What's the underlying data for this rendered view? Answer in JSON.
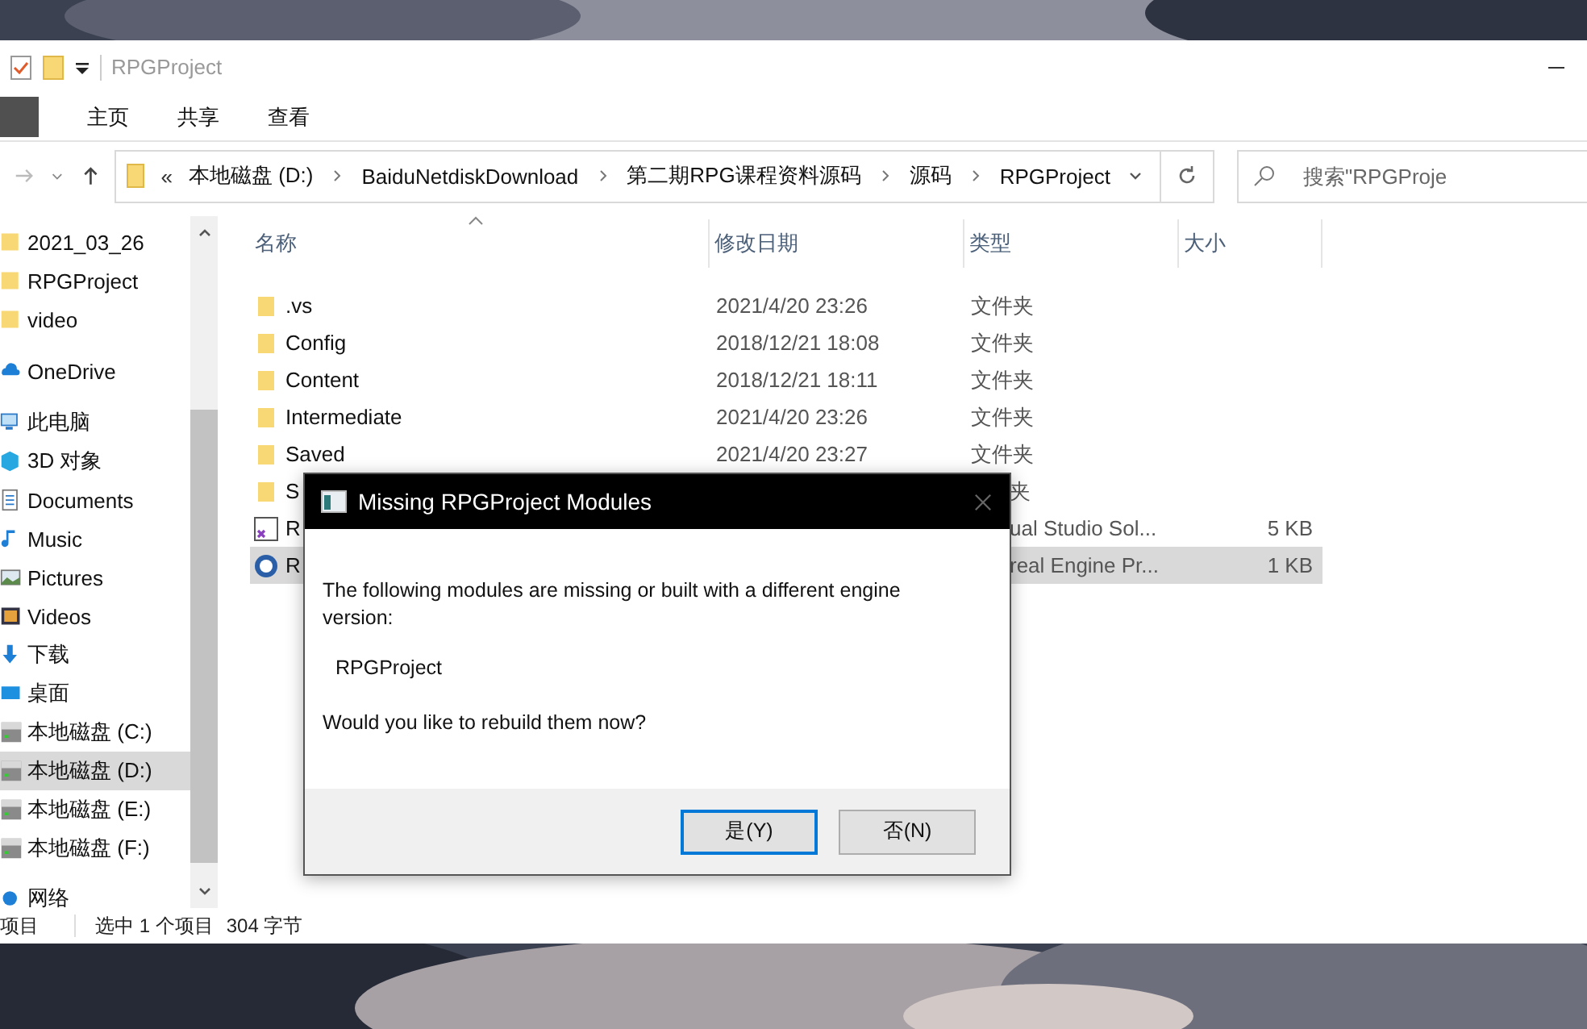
{
  "window": {
    "title": "RPGProject"
  },
  "ribbon_tabs": [
    {
      "label": "主页",
      "selected": false
    },
    {
      "label": "共享",
      "selected": false
    },
    {
      "label": "查看",
      "selected": false
    }
  ],
  "address_bar": {
    "overflow": "«",
    "crumbs": [
      "本地磁盘 (D:)",
      "BaiduNetdiskDownload",
      "第二期RPG课程资料源码",
      "源码",
      "RPGProject"
    ]
  },
  "search": {
    "placeholder": "搜索\"RPGProje"
  },
  "sidebar": {
    "items": [
      {
        "label": "2021_03_26",
        "kind": "folder",
        "selected": false
      },
      {
        "label": "RPGProject",
        "kind": "folder",
        "selected": false
      },
      {
        "label": "video",
        "kind": "folder",
        "selected": false
      },
      {
        "label": "OneDrive",
        "kind": "cloud",
        "selected": false
      },
      {
        "label": "此电脑",
        "kind": "pc",
        "selected": false
      },
      {
        "label": "3D 对象",
        "kind": "cube",
        "selected": false
      },
      {
        "label": "Documents",
        "kind": "doc",
        "selected": false
      },
      {
        "label": "Music",
        "kind": "music",
        "selected": false
      },
      {
        "label": "Pictures",
        "kind": "pictures",
        "selected": false
      },
      {
        "label": "Videos",
        "kind": "videos",
        "selected": false
      },
      {
        "label": "下载",
        "kind": "download",
        "selected": false
      },
      {
        "label": "桌面",
        "kind": "desktop",
        "selected": false
      },
      {
        "label": "本地磁盘 (C:)",
        "kind": "drive",
        "selected": false
      },
      {
        "label": "本地磁盘 (D:)",
        "kind": "drive",
        "selected": true
      },
      {
        "label": "本地磁盘 (E:)",
        "kind": "drive",
        "selected": false
      },
      {
        "label": "本地磁盘 (F:)",
        "kind": "drive",
        "selected": false
      },
      {
        "label": "网络",
        "kind": "network",
        "selected": false
      }
    ]
  },
  "table": {
    "columns": [
      "名称",
      "修改日期",
      "类型",
      "大小"
    ],
    "rows": [
      {
        "kind": "folder",
        "name": ".vs",
        "date": "2021/4/20 23:26",
        "type": "文件夹",
        "selected": false,
        "covered": false
      },
      {
        "kind": "folder",
        "name": "Config",
        "date": "2018/12/21 18:08",
        "type": "文件夹",
        "selected": false,
        "covered": false
      },
      {
        "kind": "folder",
        "name": "Content",
        "date": "2018/12/21 18:11",
        "type": "文件夹",
        "selected": false,
        "covered": false
      },
      {
        "kind": "folder",
        "name": "Intermediate",
        "date": "2021/4/20 23:26",
        "type": "文件夹",
        "selected": false,
        "covered": false
      },
      {
        "kind": "folder",
        "name": "Saved",
        "date": "2021/4/20 23:27",
        "type": "文件夹",
        "selected": false,
        "covered": false
      },
      {
        "kind": "folder",
        "name": "S",
        "type": "夹",
        "selected": false,
        "covered": true
      },
      {
        "kind": "solution",
        "name": "R",
        "type": "ual Studio Sol...",
        "size": "5 KB",
        "selected": false,
        "covered": true
      },
      {
        "kind": "uproject",
        "name": "R",
        "type": "real Engine Pr...",
        "size": "1 KB",
        "selected": true,
        "covered": true
      }
    ]
  },
  "status_bar": {
    "count": "项目",
    "selection": "选中 1 个项目",
    "size": "304 字节"
  },
  "dialog": {
    "title": "Missing RPGProject Modules",
    "message": "The following modules are missing or built with a different engine version:",
    "module": "RPGProject",
    "question": "Would you like to rebuild them now?",
    "buttons": [
      {
        "label": "是(Y)",
        "selected": true
      },
      {
        "label": "否(N)",
        "selected": false
      }
    ]
  }
}
